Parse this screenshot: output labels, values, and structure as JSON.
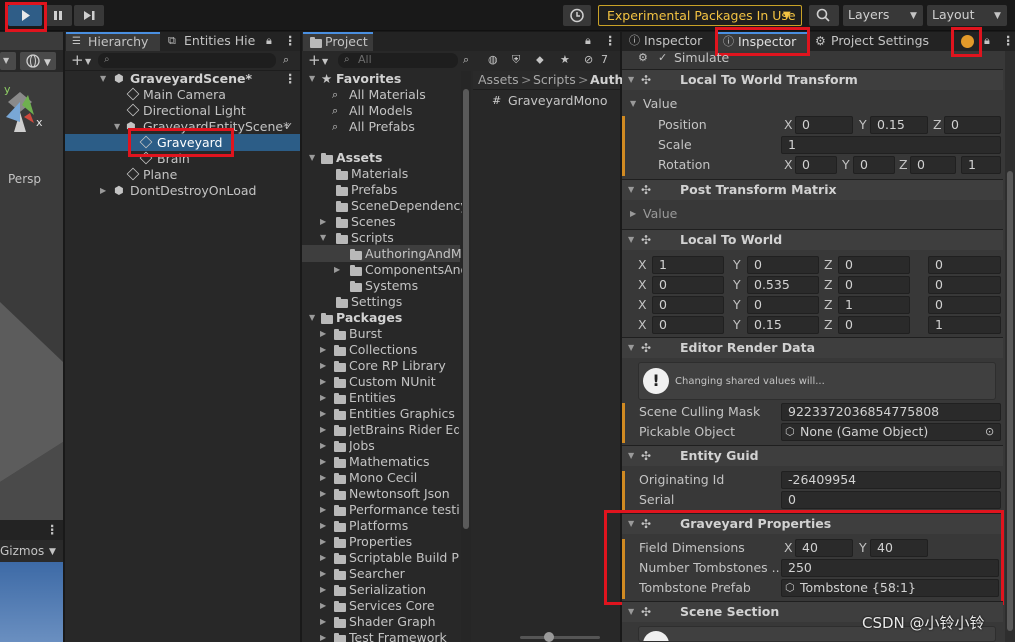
{
  "toolbar": {
    "play_icon": "play-icon",
    "pause_icon": "pause-icon",
    "step_icon": "step-icon",
    "history_icon": "history-icon",
    "experimental": "Experimental Packages In Use",
    "search_icon": "search-icon",
    "layers": "Layers",
    "layout": "Layout"
  },
  "scene": {
    "persp": "Persp",
    "gizmos": "Gizmos",
    "axis_y": "y",
    "axis_x": "x"
  },
  "hierarchy": {
    "tab_hierarchy": "Hierarchy",
    "tab_entities": "Entities Hie",
    "items": [
      {
        "label": "GraveyardScene*"
      },
      {
        "label": "Main Camera"
      },
      {
        "label": "Directional Light"
      },
      {
        "label": "GraveyardEntityScene*"
      },
      {
        "label": "Graveyard"
      },
      {
        "label": "Brain"
      },
      {
        "label": "Plane"
      },
      {
        "label": "DontDestroyOnLoad"
      }
    ]
  },
  "project": {
    "tab": "Project",
    "search_placeholder": "All",
    "filter_count": "7",
    "breadcrumb": [
      "Assets",
      "Scripts",
      "Auth"
    ],
    "file": "GraveyardMono",
    "favorites": {
      "title": "Favorites",
      "items": [
        "All Materials",
        "All Models",
        "All Prefabs"
      ]
    },
    "assets": {
      "title": "Assets",
      "items": [
        "Materials",
        "Prefabs",
        "SceneDependency",
        "Scenes",
        "Scripts",
        "AuthoringAndMo",
        "ComponentsAnd",
        "Systems",
        "Settings"
      ]
    },
    "packages": {
      "title": "Packages",
      "items": [
        "Burst",
        "Collections",
        "Core RP Library",
        "Custom NUnit",
        "Entities",
        "Entities Graphics",
        "JetBrains Rider Edit",
        "Jobs",
        "Mathematics",
        "Mono Cecil",
        "Newtonsoft Json",
        "Performance testing",
        "Platforms",
        "Properties",
        "Scriptable Build Pip",
        "Searcher",
        "Serialization",
        "Services Core",
        "Shader Graph",
        "Test Framework"
      ]
    }
  },
  "inspector": {
    "tab1": "Inspector",
    "tab2": "Inspector",
    "tab3": "Project Settings",
    "simulate": "Simulate",
    "ltw": {
      "title": "Local To World Transform",
      "value": "Value",
      "position": "Position",
      "pos": [
        "0",
        "0.15",
        "0"
      ],
      "scale": "Scale",
      "scale_val": "1",
      "rotation": "Rotation",
      "rot": [
        "0",
        "0",
        "0",
        "1"
      ]
    },
    "ptm": {
      "title": "Post Transform Matrix",
      "value": "Value"
    },
    "ltw2": {
      "title": "Local To World",
      "rows": [
        [
          "1",
          "0",
          "0",
          "0"
        ],
        [
          "0",
          "0.535",
          "0",
          "0"
        ],
        [
          "0",
          "0",
          "1",
          "0"
        ],
        [
          "0",
          "0.15",
          "0",
          "1"
        ]
      ]
    },
    "erd": {
      "title": "Editor Render Data",
      "warning": "Changing shared values will...",
      "culling_label": "Scene Culling Mask",
      "culling_val": "9223372036854775808",
      "pickable_label": "Pickable Object",
      "pickable_val": "None (Game Object)"
    },
    "guid": {
      "title": "Entity Guid",
      "orig_label": "Originating Id",
      "orig_val": "-26409954",
      "serial_label": "Serial",
      "serial_val": "0"
    },
    "graveyard": {
      "title": "Graveyard Properties",
      "field_label": "Field Dimensions",
      "fx": "40",
      "fy": "40",
      "num_label": "Number Tombstones ...",
      "num_val": "250",
      "prefab_label": "Tombstone Prefab",
      "prefab_val": "Tombstone {58:1}"
    },
    "scene_section": {
      "title": "Scene Section"
    }
  },
  "watermark": "CSDN @小铃小铃"
}
